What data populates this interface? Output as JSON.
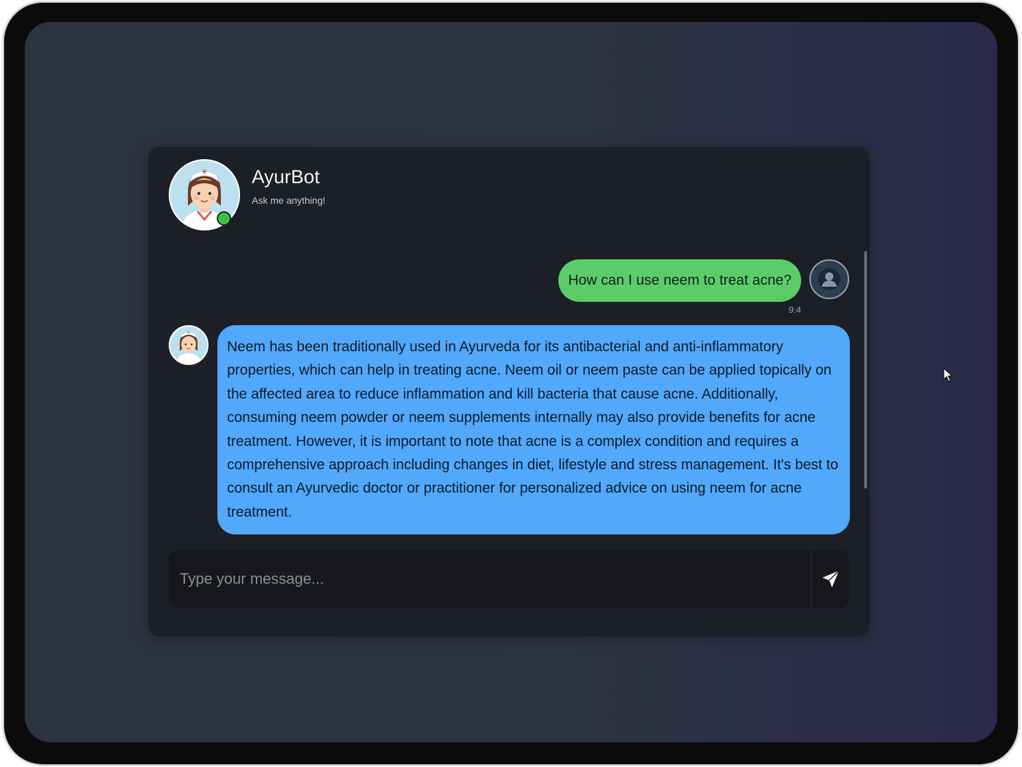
{
  "header": {
    "title": "AyurBot",
    "subtitle": "Ask me anything!",
    "avatar_icon": "nurse-avatar-icon",
    "status": "online"
  },
  "messages": [
    {
      "sender": "user",
      "text": "How can I use neem to treat acne?",
      "time": "9:4"
    },
    {
      "sender": "bot",
      "text": "Neem has been traditionally used in Ayurveda for its antibacterial and anti-inflammatory properties, which can help in treating acne. Neem oil or neem paste can be applied topically on the affected area to reduce inflammation and kill bacteria that cause acne. Additionally, consuming neem powder or neem supplements internally may also provide benefits for acne treatment. However, it is important to note that acne is a complex condition and requires a comprehensive approach including changes in diet, lifestyle and stress management. It's best to consult an Ayurvedic doctor or practitioner for personalized advice on using neem for acne treatment.",
      "time": ""
    }
  ],
  "composer": {
    "placeholder": "Type your message...",
    "value": "",
    "send_icon": "send-icon"
  },
  "colors": {
    "user_bubble": "#5ccc6a",
    "bot_bubble": "#52a8fa",
    "panel": "#1d1f26",
    "online": "#3ec23e"
  }
}
